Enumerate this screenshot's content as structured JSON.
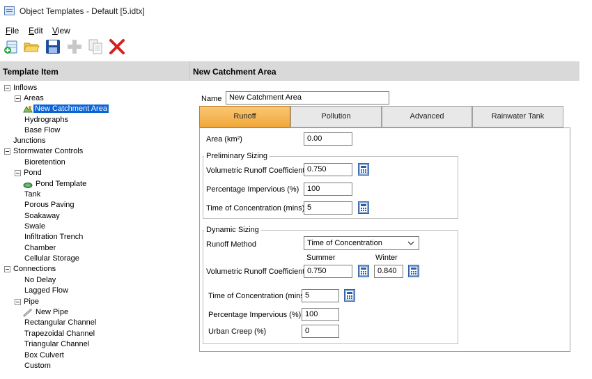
{
  "window": {
    "title": "Object Templates - Default [5.idtx]"
  },
  "menu": {
    "items": [
      {
        "key": "F",
        "rest": "ile"
      },
      {
        "key": "E",
        "rest": "dit"
      },
      {
        "key": "V",
        "rest": "iew"
      }
    ]
  },
  "toolbar": {
    "icons": [
      "new-template-icon",
      "open-folder-icon",
      "save-icon",
      "add-icon",
      "copy-icon",
      "delete-icon"
    ],
    "colors": {
      "folder": "#f3c64a",
      "save": "#1f4e9c",
      "delete": "#d62020",
      "add_disabled": "#c8c8c8"
    }
  },
  "left_panel": {
    "header": "Template Item",
    "tree": [
      "Inflows",
      "Areas",
      "New Catchment Area",
      "Hydrographs",
      "Base Flow",
      "Junctions",
      "Stormwater Controls",
      "Bioretention",
      "Pond",
      "Pond Template",
      "Tank",
      "Porous Paving",
      "Soakaway",
      "Swale",
      "Infiltration Trench",
      "Chamber",
      "Cellular Storage",
      "Connections",
      "No Delay",
      "Lagged Flow",
      "Pipe",
      "New Pipe",
      "Rectangular Channel",
      "Trapezoidal Channel",
      "Triangular Channel",
      "Box Culvert",
      "Custom"
    ]
  },
  "right_panel": {
    "header": "New Catchment Area",
    "name_label": "Name",
    "name_value": "New Catchment Area",
    "tabs": [
      "Runoff",
      "Pollution",
      "Advanced",
      "Rainwater Tank"
    ],
    "active_tab_color": "#f2a83b",
    "area_label": "Area (km²)",
    "area_value": "0.00",
    "preliminary": {
      "title": "Preliminary Sizing",
      "vrc_label": "Volumetric Runoff Coefficient",
      "vrc_value": "0.750",
      "pi_label": "Percentage Impervious (%)",
      "pi_value": "100",
      "toc_label": "Time of Concentration (mins)",
      "toc_value": "5"
    },
    "dynamic": {
      "title": "Dynamic Sizing",
      "method_label": "Runoff Method",
      "method_value": "Time of Concentration",
      "summer_label": "Summer",
      "winter_label": "Winter",
      "vrc_label": "Volumetric Runoff Coefficient",
      "vrc_summer": "0.750",
      "vrc_winter": "0.840",
      "toc_label": "Time of Concentration (mins)",
      "toc_value": "5",
      "pi_label": "Percentage Impervious (%)",
      "pi_value": "100",
      "creep_label": "Urban Creep (%)",
      "creep_value": "0"
    }
  }
}
